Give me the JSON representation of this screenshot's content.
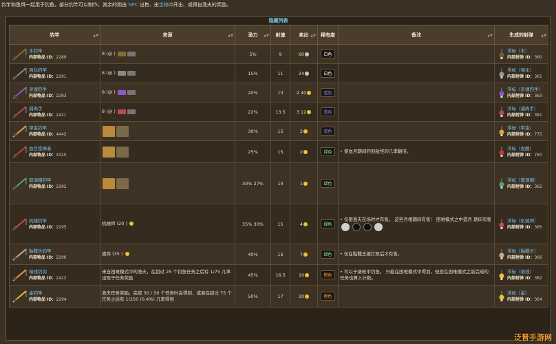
{
  "intro": {
    "a": "钓竿和鱼饵一起用于钓鱼。部分钓竿可以制作，其余的则由 ",
    "npc": "NPC",
    "b": " 出售、由",
    "chest": "宝箱",
    "c": "中开出、或得自渔夫的奖励。"
  },
  "table_caption": "隐藏列表",
  "headers": {
    "rod": "钓竿",
    "source": "来源",
    "power": "渔力",
    "speed": "射速",
    "sell": "卖出",
    "rarity": "稀有度",
    "notes": "备注",
    "bobber": "生成的射弹"
  },
  "rows": [
    {
      "name": "木钓竿",
      "id_label": "内部物品 ID：",
      "id": "2289",
      "source": "8 (@ )",
      "power": "5%",
      "speed": "9",
      "sell": "60",
      "rarity": "白色",
      "rarity_class": "rar-white",
      "note": "",
      "bobber": "浮标（木）",
      "bobber_id_label": "内部射弹 ID：",
      "bobber_id": "360",
      "rod_color": "#8a6a3a",
      "bob_color": "#7a5a33"
    },
    {
      "name": "强化钓竿",
      "id_label": "内部物品 ID：",
      "id": "2291",
      "source": "8 (@ )",
      "power": "15%",
      "speed": "11",
      "sell": "24",
      "rarity": "白色",
      "rarity_class": "rar-white",
      "note": "",
      "bobber": "浮标（强化）",
      "bobber_id_label": "内部射弹 ID：",
      "bobber_id": "361",
      "rod_color": "#8a8a8a",
      "bob_color": "#9a9a9a"
    },
    {
      "name": "灵魂钓手",
      "id_label": "内部物品 ID：",
      "id": "2293",
      "source": "8 (@ )",
      "power": "20%",
      "speed": "13",
      "sell": "2  40",
      "rarity": "蓝色",
      "rarity_class": "rar-blue",
      "note": "",
      "bobber": "浮标（灵魂钓手）",
      "bobber_id_label": "内部射弹 ID：",
      "bobber_id": "363",
      "rod_color": "#8a5ac8",
      "bob_color": "#8a5ac8"
    },
    {
      "name": "捕肉手",
      "id_label": "内部物品 ID：",
      "id": "2421",
      "source": "8 (@ )",
      "power": "22%",
      "speed": "13.5",
      "sell": "3  12",
      "rarity": "蓝色",
      "rarity_class": "rar-blue",
      "note": "",
      "bobber": "浮标（捕肉手）",
      "bobber_id_label": "内部射弹 ID：",
      "bobber_id": "381",
      "rod_color": "#b84a5a",
      "bob_color": "#b84a5a"
    },
    {
      "name": "甲虫钓竿",
      "id_label": "内部物品 ID：",
      "id": "4442",
      "source": "",
      "power": "30%",
      "speed": "15",
      "sell": "2",
      "rarity": "蓝色",
      "rarity_class": "rar-blue",
      "note": "",
      "bobber": "浮标（甲虫）",
      "bobber_id_label": "内部射弹 ID：",
      "bobber_id": "775",
      "rod_color": "#d8a83a",
      "bob_color": "#d8a83a"
    },
    {
      "name": "血巨投掷者",
      "id_label": "内部物品 ID：",
      "id": "4325",
      "source": "",
      "power": "25%",
      "speed": "15",
      "sell": "2",
      "rarity": "绿色",
      "rarity_class": "rar-green",
      "note": "使血月期间钓到敌怪的几率翻倍。",
      "bobber": "浮标（血腥）",
      "bobber_id_label": "内部射弹 ID：",
      "bobber_id": "760",
      "rod_color": "#c83a3a",
      "bob_color": "#c83a3a"
    },
    {
      "name": "玻璃钢钓竿",
      "id_label": "内部物品 ID：",
      "id": "2292",
      "source": "",
      "power": "30%  27%",
      "speed": "14",
      "sell": "1",
      "rarity": "绿色",
      "rarity_class": "rar-green",
      "note": "",
      "bobber": "浮标（玻璃钢）",
      "bobber_id_label": "内部射弹 ID：",
      "bobber_id": "362",
      "rod_color": "#4aa87a",
      "bob_color": "#4aa87a"
    },
    {
      "name": "机械钓竿",
      "id_label": "内部物品 ID：",
      "id": "2295",
      "source": "机械师 (20 )",
      "power": "35%  30%",
      "speed": "15",
      "sell": "4",
      "rarity": "绿色",
      "rarity_class": "rar-green",
      "note": "仅限渔夫在场时才有售。 这些月相期间有售： 困难模式之中提月 期间有售",
      "bobber": "浮标（机械师）",
      "bobber_id_label": "内部射弹 ID：",
      "bobber_id": "365",
      "rod_color": "#c84a4a",
      "bob_color": "#c84a4a"
    },
    {
      "name": "骷髅头钓竿",
      "id_label": "内部物品 ID：",
      "id": "2296",
      "source": "旅商 (35 )",
      "power": "40%",
      "speed": "16",
      "sell": "7",
      "rarity": "绿色",
      "rarity_class": "rar-green",
      "note": "仅在骷髅王被打败后才有售。",
      "bobber": "浮标（骷髅头）",
      "bobber_id_label": "内部射弹 ID：",
      "bobber_id": "366",
      "rod_color": "#b8b0a0",
      "bob_color": "#b8b0a0"
    },
    {
      "name": "熔线钓钩",
      "id_label": "内部物品 ID：",
      "id": "2422",
      "source": "来自困难模式中的渔夫，在超过 25 个钓鱼任务之后有 1/75 几率出现于任务奖励",
      "power": "45%",
      "speed": "16.5",
      "sell": "10",
      "rarity": "橙色",
      "rarity_class": "rar-orange",
      "note": "可以于熔岩中钓鱼。 只能在困难模式中得到，但是在困难模式之前完成的任务也算入计数。",
      "bobber": "浮标（熔线）",
      "bobber_id_label": "内部射弹 ID：",
      "bobber_id": "382",
      "rod_color": "#e8a03a",
      "bob_color": "#f0c040"
    },
    {
      "name": "金钓竿",
      "id_label": "内部物品 ID：",
      "id": "2294",
      "source": "渔夫任务奖励，完成 30  / 50  个任务时会得到，或者在超过 75 个任务之后有 1/250 (0.4%) 几率得到",
      "power": "50%",
      "speed": "17",
      "sell": "20",
      "rarity": "橙色",
      "rarity_class": "rar-orange",
      "note": "",
      "bobber": "浮标（金）",
      "bobber_id_label": "内部射弹 ID：",
      "bobber_id": "364",
      "rod_color": "#e8c23a",
      "bob_color": "#e8c23a"
    }
  ],
  "watermark": "泛普手游网"
}
